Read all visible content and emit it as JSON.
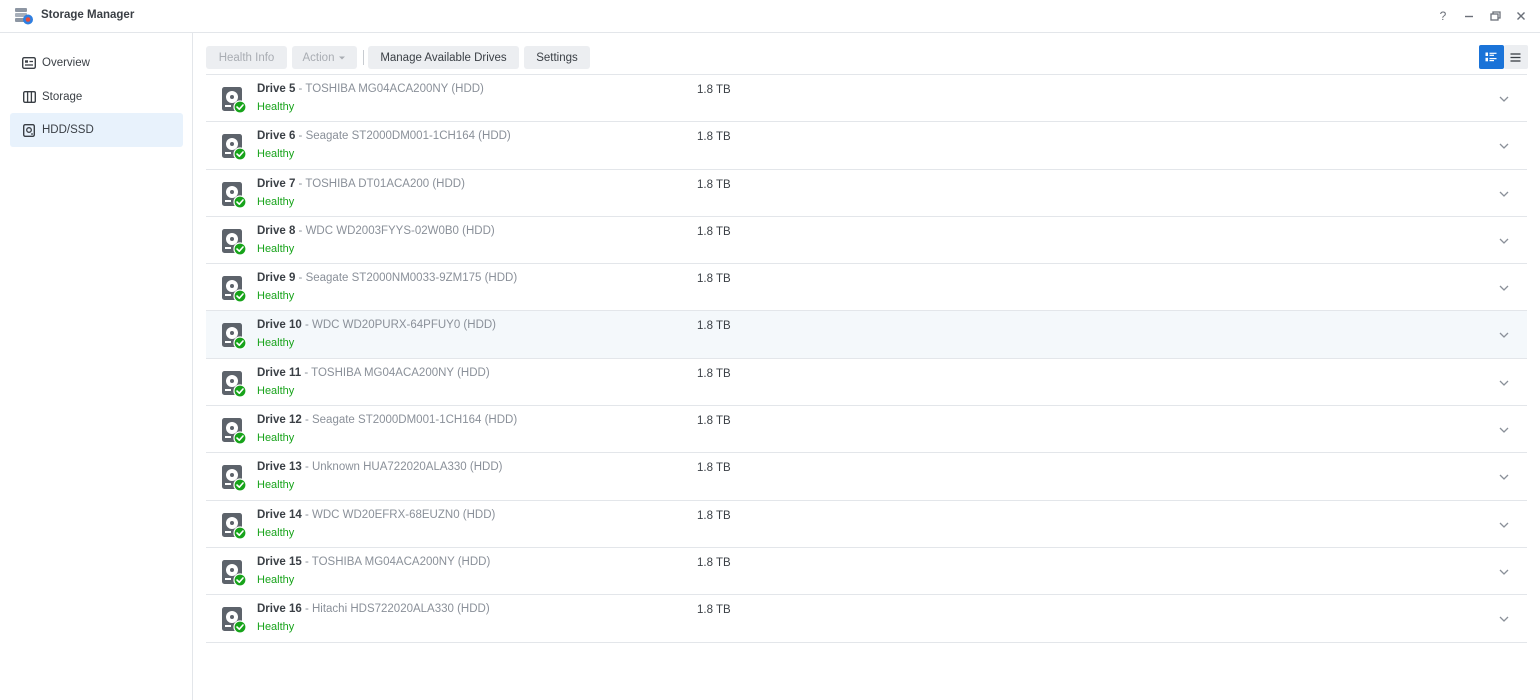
{
  "window": {
    "title": "Storage Manager",
    "app_icon": "storage-manager-icon",
    "controls": [
      "help-icon",
      "minimize-icon",
      "restore-icon",
      "close-icon"
    ]
  },
  "sidebar": {
    "items": [
      {
        "label": "Overview",
        "icon": "overview-icon",
        "active": false
      },
      {
        "label": "Storage",
        "icon": "storage-icon",
        "active": false
      },
      {
        "label": "HDD/SSD",
        "icon": "hdd-icon",
        "active": true
      }
    ]
  },
  "toolbar": {
    "health_info_label": "Health Info",
    "action_label": "Action",
    "manage_drives_label": "Manage Available Drives",
    "settings_label": "Settings"
  },
  "view_toggle": {
    "selected": "detail-view",
    "options": [
      "detail-view-icon",
      "list-view-icon"
    ],
    "accent": "#1a73d8"
  },
  "status_color": "#17a31a",
  "drives": [
    {
      "name": "Drive 5",
      "model": " - TOSHIBA MG04ACA200NY (HDD)",
      "status": "Healthy",
      "size": "1.8 TB"
    },
    {
      "name": "Drive 6",
      "model": " - Seagate ST2000DM001-1CH164 (HDD)",
      "status": "Healthy",
      "size": "1.8 TB"
    },
    {
      "name": "Drive 7",
      "model": " - TOSHIBA DT01ACA200 (HDD)",
      "status": "Healthy",
      "size": "1.8 TB"
    },
    {
      "name": "Drive 8",
      "model": " - WDC WD2003FYYS-02W0B0 (HDD)",
      "status": "Healthy",
      "size": "1.8 TB"
    },
    {
      "name": "Drive 9",
      "model": " - Seagate ST2000NM0033-9ZM175 (HDD)",
      "status": "Healthy",
      "size": "1.8 TB"
    },
    {
      "name": "Drive 10",
      "model": " - WDC WD20PURX-64PFUY0 (HDD)",
      "status": "Healthy",
      "size": "1.8 TB"
    },
    {
      "name": "Drive 11",
      "model": " - TOSHIBA MG04ACA200NY (HDD)",
      "status": "Healthy",
      "size": "1.8 TB"
    },
    {
      "name": "Drive 12",
      "model": " - Seagate ST2000DM001-1CH164 (HDD)",
      "status": "Healthy",
      "size": "1.8 TB"
    },
    {
      "name": "Drive 13",
      "model": " - Unknown HUA722020ALA330 (HDD)",
      "status": "Healthy",
      "size": "1.8 TB"
    },
    {
      "name": "Drive 14",
      "model": " - WDC WD20EFRX-68EUZN0 (HDD)",
      "status": "Healthy",
      "size": "1.8 TB"
    },
    {
      "name": "Drive 15",
      "model": " - TOSHIBA MG04ACA200NY (HDD)",
      "status": "Healthy",
      "size": "1.8 TB"
    },
    {
      "name": "Drive 16",
      "model": " - Hitachi HDS722020ALA330 (HDD)",
      "status": "Healthy",
      "size": "1.8 TB"
    }
  ]
}
